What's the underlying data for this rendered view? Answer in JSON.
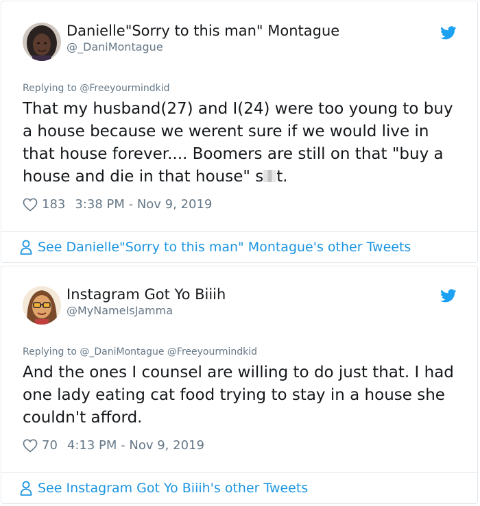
{
  "tweets": [
    {
      "author_name": "Danielle\"Sorry to this man\" Montague",
      "author_handle": "@_DaniMontague",
      "replying_to": "Replying to @Freeyourmindkid",
      "text_before": "That my husband(27) and I(24) were too young to buy a house because we werent sure if we would live in that house forever....  Boomers are still on that \"buy a house and die in that house\" s",
      "text_after": "t.",
      "likes": "183",
      "timestamp": "3:38 PM - Nov 9, 2019",
      "see_more": "See Danielle\"Sorry to this man\" Montague's other Tweets",
      "avatar_icon": "avatar-photo"
    },
    {
      "author_name": "Instagram Got Yo Biiih",
      "author_handle": "@MyNameIsJamma",
      "replying_to": "Replying to @_DaniMontague @Freeyourmindkid",
      "text": "And the ones I counsel are willing to do just that. I had one lady eating cat food trying to stay in a house she couldn't afford.",
      "likes": "70",
      "timestamp": "4:13 PM - Nov 9, 2019",
      "see_more": "See Instagram Got Yo Biiih's other Tweets",
      "avatar_icon": "avatar-cartoon"
    }
  ],
  "colors": {
    "twitter_blue": "#1da1f2",
    "link_blue": "#1b95e0",
    "muted_gray": "#657786",
    "text_dark": "#14171a",
    "border": "#e1e8ed"
  },
  "icons": {
    "brand": "twitter-bird-icon",
    "like": "heart-icon",
    "profile": "person-icon"
  }
}
